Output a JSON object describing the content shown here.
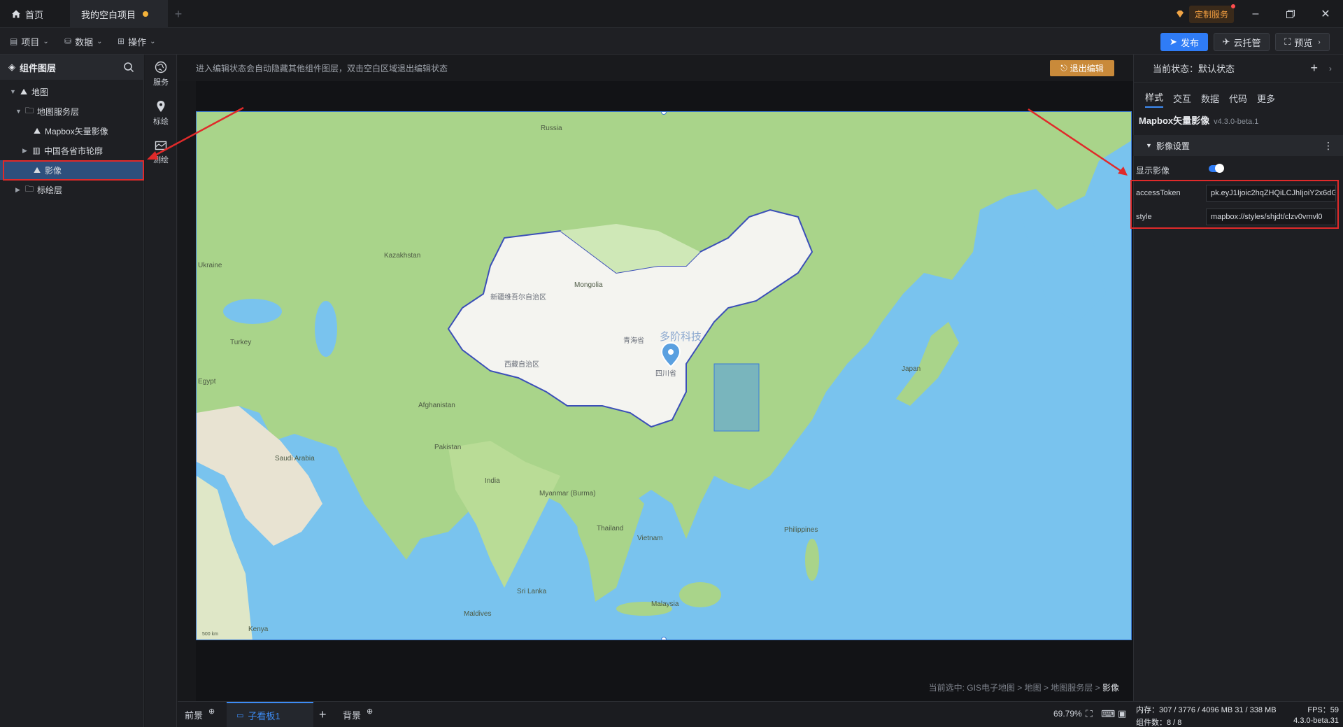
{
  "titlebar": {
    "home_tab": "首页",
    "project_tab": "我的空白项目",
    "custom_service": "定制服务"
  },
  "menubar": {
    "project": "项目",
    "data": "数据",
    "operate": "操作",
    "publish": "发布",
    "cloud": "云托管",
    "preview": "预览"
  },
  "layers": {
    "title": "组件图层",
    "items": [
      {
        "label": "地图",
        "depth": 0
      },
      {
        "label": "地图服务层",
        "depth": 1
      },
      {
        "label": "Mapbox矢量影像",
        "depth": 2
      },
      {
        "label": "中国各省市轮廓",
        "depth": 2
      },
      {
        "label": "影像",
        "depth": 2
      },
      {
        "label": "标绘层",
        "depth": 1
      }
    ]
  },
  "tools": {
    "service": "服务",
    "marker": "标绘",
    "measure": "测绘"
  },
  "canvas": {
    "hint": "进入编辑状态会自动隐藏其他组件图层，双击空白区域退出编辑状态",
    "exit_edit": "退出编辑",
    "breadcrumb_prefix": "当前选中: GIS电子地图 > 地图 > 地图服务层 > ",
    "breadcrumb_current": "影像"
  },
  "map": {
    "labels": {
      "russia": "Russia",
      "kazakhstan": "Kazakhstan",
      "mongolia": "Mongolia",
      "india": "India",
      "saudi": "Saudi Arabia",
      "xinjiang": "新疆维吾尔自治区",
      "tibet": "西藏自治区",
      "qinghai": "青海省",
      "sichuan": "四川省",
      "japan": "Japan",
      "thailand": "Thailand",
      "vietnam": "Vietnam",
      "watermark": "多阶科技",
      "ukraine": "Ukraine",
      "egypt": "Egypt",
      "myanmar": "Myanmar (Burma)",
      "malaysia": "Malaysia",
      "philippines": "Philippines",
      "kenya": "Kenya",
      "sri_lanka": "Sri Lanka",
      "afghanistan": "Afghanistan",
      "pakistan": "Pakistan",
      "turkey": "Turkey",
      "maldives": "Maldives",
      "scale": "500 km"
    }
  },
  "bottom": {
    "foreground": "前景",
    "subboard": "子看板1",
    "background": "背景",
    "zoom": "69.79%"
  },
  "props": {
    "state_label": "当前状态：默认状态",
    "tabs": [
      "样式",
      "交互",
      "数据",
      "代码",
      "更多"
    ],
    "component_name": "Mapbox矢量影像",
    "component_version": "v4.3.0-beta.1",
    "section": "影像设置",
    "show_image_label": "显示影像",
    "show_image": true,
    "access_token_label": "accessToken",
    "access_token_value": "pk.eyJ1Ijoic2hqZHQiLCJhIjoiY2x6dG",
    "style_label": "style",
    "style_value": "mapbox://styles/shjdt/clzv0vmvl0"
  },
  "status": {
    "memory": "内存：307 / 3776 / 4096 MB  31 / 338 MB",
    "fps": "FPS：59",
    "components": "组件数：8 / 8",
    "version": "4.3.0-beta.31"
  },
  "colors": {
    "accent": "#2f7cf6",
    "highlight_red": "#e02a2a",
    "exit_button": "#c98a3a"
  }
}
